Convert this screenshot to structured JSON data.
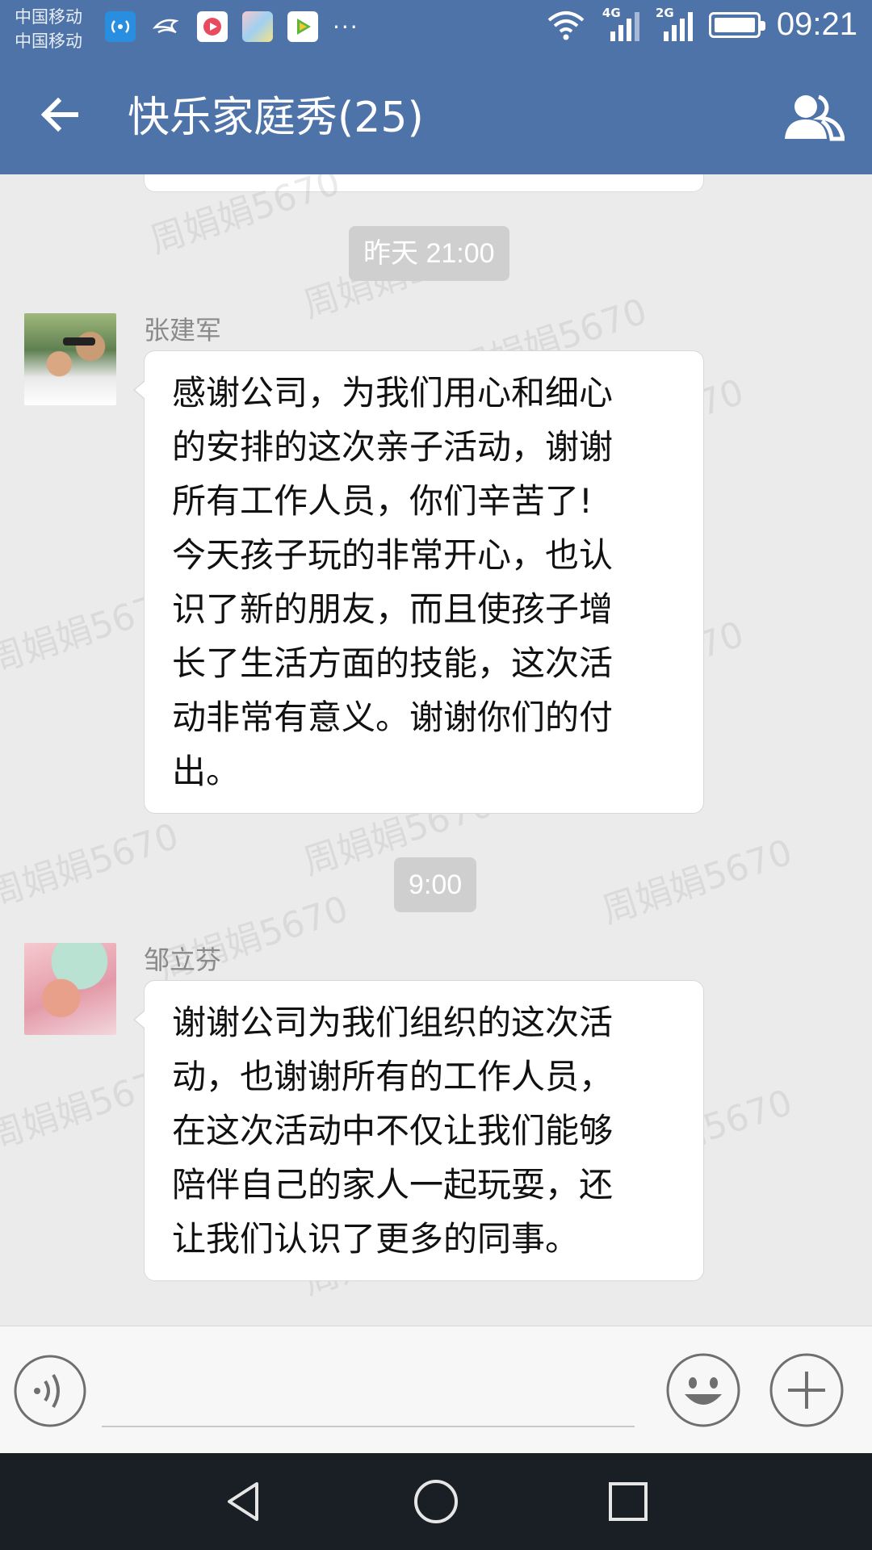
{
  "status_bar": {
    "carrier_1": "中国移动",
    "carrier_2": "中国移动",
    "network_1": "4G",
    "network_2": "2G",
    "more": "···",
    "time": "09:21"
  },
  "header": {
    "title": "快乐家庭秀(25)",
    "color": "#4e73a8"
  },
  "messages": [
    {
      "timestamp": "昨天  21:00",
      "sender": "张建军",
      "text_lines": [
        "感谢公司，为我们用心和细心",
        "的安排的这次亲子活动，谢谢",
        "所有工作人员，你们辛苦了!",
        "今天孩子玩的非常开心，也认",
        "识了新的朋友，而且使孩子增",
        "长了生活方面的技能，这次活",
        "动非常有意义。谢谢你们的付",
        "出。"
      ]
    },
    {
      "timestamp": "9:00",
      "sender": "邹立芬",
      "text_lines": [
        "谢谢公司为我们组织的这次活",
        "动，也谢谢所有的工作人员，",
        "在这次活动中不仅让我们能够",
        "陪伴自己的家人一起玩耍，还",
        "让我们认识了更多的同事。"
      ]
    }
  ],
  "watermark": "周娟娟5670",
  "input": {
    "value": "",
    "placeholder": ""
  },
  "icons": {
    "back": "back-arrow-icon",
    "group": "group-members-icon",
    "voice": "voice-icon",
    "emoji": "emoji-icon",
    "plus": "plus-icon",
    "nav_back": "nav-back-icon",
    "nav_home": "nav-home-icon",
    "nav_recent": "nav-recent-icon"
  }
}
